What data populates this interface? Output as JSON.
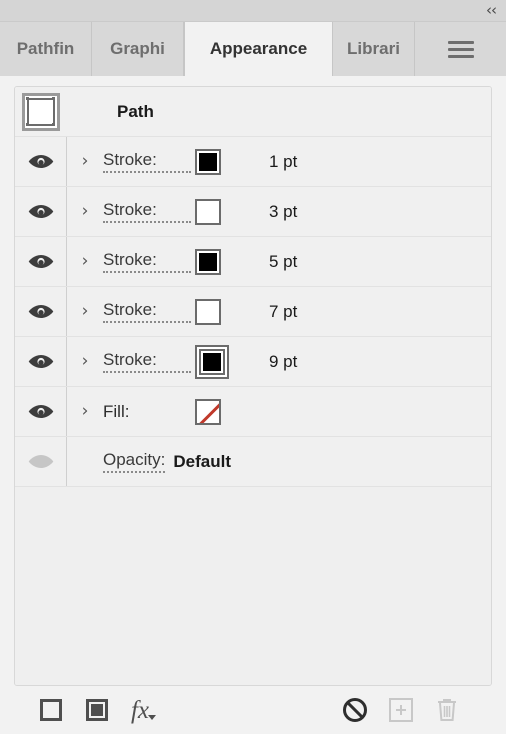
{
  "window": {
    "collapse_icon": "double-chevron-left-icon",
    "menu_icon": "panel-menu-hamburger-icon"
  },
  "tabs": [
    {
      "label": "Pathfin",
      "name": "tab-pathfinder",
      "active": false
    },
    {
      "label": "Graphi",
      "name": "tab-graphic-styles",
      "active": false
    },
    {
      "label": "Appearance",
      "name": "tab-appearance",
      "active": true
    },
    {
      "label": "Librari",
      "name": "tab-libraries",
      "active": false
    }
  ],
  "object": {
    "name": "Path",
    "icon": "path-thumbnail-icon"
  },
  "rows": [
    {
      "label": "Stroke:",
      "value": "1 pt",
      "swatch": "black",
      "visible": true,
      "has_disclosure": true,
      "selected": false
    },
    {
      "label": "Stroke:",
      "value": "3 pt",
      "swatch": "white",
      "visible": true,
      "has_disclosure": true,
      "selected": false
    },
    {
      "label": "Stroke:",
      "value": "5 pt",
      "swatch": "black",
      "visible": true,
      "has_disclosure": true,
      "selected": false
    },
    {
      "label": "Stroke:",
      "value": "7 pt",
      "swatch": "white",
      "visible": true,
      "has_disclosure": true,
      "selected": false
    },
    {
      "label": "Stroke:",
      "value": "9 pt",
      "swatch": "black",
      "visible": true,
      "has_disclosure": true,
      "selected": true
    },
    {
      "label": "Fill:",
      "value": "",
      "swatch": "none",
      "visible": true,
      "has_disclosure": true,
      "selected": false
    }
  ],
  "opacity": {
    "label": "Opacity:",
    "value": "Default",
    "visibility_enabled": false
  },
  "toolbar": {
    "add_new_stroke": "add-new-stroke-icon",
    "add_new_fill": "add-new-fill-icon",
    "add_effect": "fx",
    "clear_appearance": "clear-appearance-icon",
    "duplicate_item": "duplicate-selected-item-icon",
    "delete_item": "delete-selected-item-icon"
  },
  "colors": {
    "panel_bg": "#dcdcdc",
    "body_bg": "#f2f2f2",
    "row_bg": "#f0f0f0",
    "tab_active_bg": "#f2f2f2",
    "tab_inactive_bg": "#d8d8d8",
    "text": "#2b2b2b",
    "none_slash": "#c0392b"
  }
}
